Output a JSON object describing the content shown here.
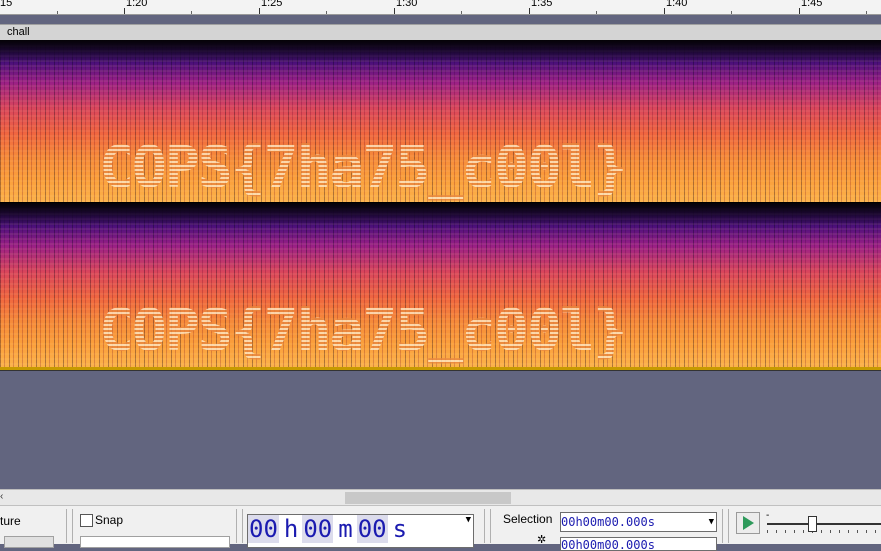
{
  "ruler": {
    "labels": [
      ":15",
      "1:20",
      "1:25",
      "1:30",
      "1:35",
      "1:40",
      "1:45"
    ]
  },
  "track": {
    "name": "chall"
  },
  "spectrogram": {
    "channel1_text": "COPS{7ha75_c00l}",
    "channel2_text": "COPS{7ha75_c00l}"
  },
  "colors": {
    "background": "#62657f",
    "time_digits": "#1b1bb0",
    "play": "#2e9a5b",
    "track_edge": "#c79a00"
  },
  "scrollbar": {
    "left_arrow": "‹"
  },
  "toolbar": {
    "capture_label": "ture",
    "snap_label": "Snap",
    "snap_checked": false,
    "time_main": {
      "h": "00",
      "h_unit": "h",
      "m": "00",
      "m_unit": "m",
      "s": "00",
      "s_unit": "s"
    },
    "selection_label": "Selection",
    "selection_start": "00h00m00.000s",
    "selection_end": "00h00m00.000s",
    "play_icon": "play-icon",
    "speed_minus": "-"
  }
}
